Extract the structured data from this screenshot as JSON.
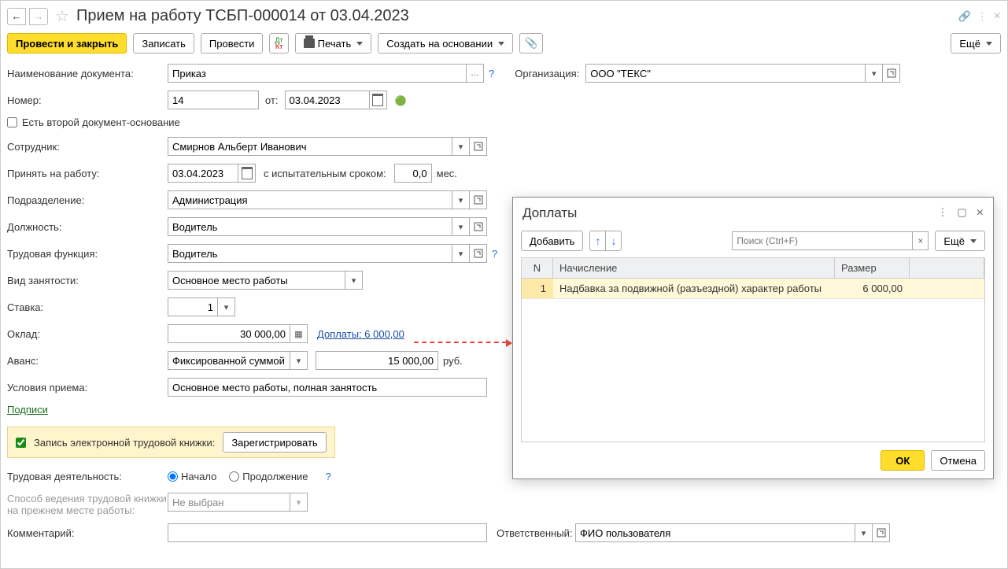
{
  "header": {
    "title": "Прием на работу ТСБП-000014 от 03.04.2023"
  },
  "toolbar": {
    "post_close": "Провести и закрыть",
    "save": "Записать",
    "post": "Провести",
    "print": "Печать",
    "create_based": "Создать на основании",
    "more": "Ещё"
  },
  "form": {
    "doc_name_label": "Наименование документа:",
    "doc_name_value": "Приказ",
    "org_label": "Организация:",
    "org_value": "ООО \"ТЕКС\"",
    "number_label": "Номер:",
    "number_value": "14",
    "from_label": "от:",
    "date_value": "03.04.2023",
    "second_doc_label": "Есть второй документ-основание",
    "employee_label": "Сотрудник:",
    "employee_value": "Смирнов Альберт Иванович",
    "hire_date_label": "Принять на работу:",
    "hire_date_value": "03.04.2023",
    "probation_label": "с испытательным сроком:",
    "probation_value": "0,0",
    "probation_unit": "мес.",
    "department_label": "Подразделение:",
    "department_value": "Администрация",
    "position_label": "Должность:",
    "position_value": "Водитель",
    "labor_function_label": "Трудовая функция:",
    "labor_function_value": "Водитель",
    "employment_type_label": "Вид занятости:",
    "employment_type_value": "Основное место работы",
    "rate_label": "Ставка:",
    "rate_value": "1",
    "salary_label": "Оклад:",
    "salary_value": "30 000,00",
    "surcharges_link": "Доплаты: 6 000,00",
    "advance_label": "Аванс:",
    "advance_type_value": "Фиксированной суммой",
    "advance_amount_value": "15 000,00",
    "advance_unit": "руб.",
    "conditions_label": "Условия приема:",
    "conditions_value": "Основное место работы, полная занятость",
    "signatures_link": "Подписи",
    "etk_label": "Запись электронной трудовой книжки:",
    "register_btn": "Зарегистрировать",
    "activity_label": "Трудовая деятельность:",
    "activity_start": "Начало",
    "activity_continue": "Продолжение",
    "book_method_label": "Способ ведения трудовой книжки на прежнем месте работы:",
    "book_method_value": "Не выбран",
    "comment_label": "Комментарий:",
    "responsible_label": "Ответственный:",
    "responsible_value": "ФИО пользователя"
  },
  "popup": {
    "title": "Доплаты",
    "add_btn": "Добавить",
    "search_placeholder": "Поиск (Ctrl+F)",
    "more": "Ещё",
    "col_n": "N",
    "col_name": "Начисление",
    "col_size": "Размер",
    "row_n": "1",
    "row_name": "Надбавка за подвижной (разъездной) характер работы",
    "row_size": "6 000,00",
    "ok": "ОК",
    "cancel": "Отмена"
  }
}
